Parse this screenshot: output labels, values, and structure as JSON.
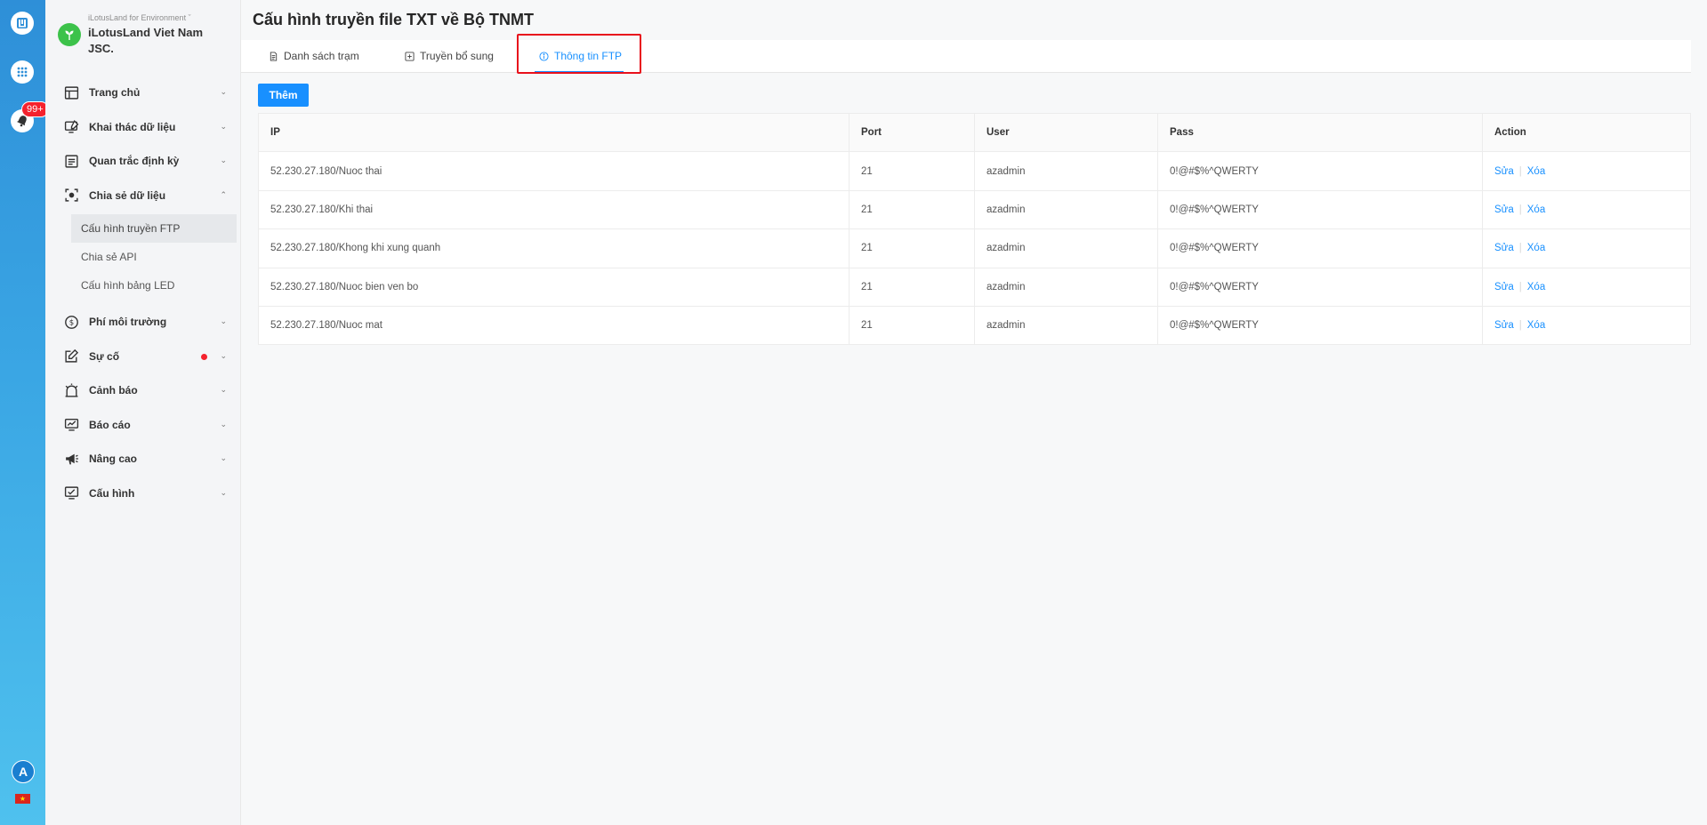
{
  "rail": {
    "badge_count": "99+",
    "avatar_letter": "A",
    "flag_star": "★"
  },
  "org": {
    "subtitle": "iLotusLand for Environment ˇ",
    "name": "iLotusLand Viet Nam JSC."
  },
  "menu": {
    "items": [
      {
        "label": "Trang chủ",
        "icon": "layout-icon"
      },
      {
        "label": "Khai thác dữ liệu",
        "icon": "monitor-edit-icon"
      },
      {
        "label": "Quan trắc định kỳ",
        "icon": "list-doc-icon"
      },
      {
        "label": "Chia sẻ dữ liệu",
        "icon": "share-scan-icon"
      },
      {
        "label": "Phí môi trường",
        "icon": "dollar-icon"
      },
      {
        "label": "Sự cố",
        "icon": "edit-icon"
      },
      {
        "label": "Cảnh báo",
        "icon": "alarm-icon"
      },
      {
        "label": "Báo cáo",
        "icon": "report-icon"
      },
      {
        "label": "Nâng cao",
        "icon": "megaphone-icon"
      },
      {
        "label": "Cấu hình",
        "icon": "config-icon"
      }
    ],
    "share_submenu": [
      "Cấu hình truyền FTP",
      "Chia sẻ API",
      "Cấu hình bảng LED"
    ]
  },
  "page": {
    "title": "Cấu hình truyền file TXT về Bộ TNMT",
    "tabs": [
      {
        "label": "Danh sách trạm"
      },
      {
        "label": "Truyền bổ sung"
      },
      {
        "label": "Thông tin FTP"
      }
    ],
    "add_button": "Thêm"
  },
  "table": {
    "columns": [
      "IP",
      "Port",
      "User",
      "Pass",
      "Action"
    ],
    "rows": [
      {
        "ip": "52.230.27.180/Nuoc thai",
        "port": "21",
        "user": "azadmin",
        "pass": "0!@#$%^QWERTY"
      },
      {
        "ip": "52.230.27.180/Khi thai",
        "port": "21",
        "user": "azadmin",
        "pass": "0!@#$%^QWERTY"
      },
      {
        "ip": "52.230.27.180/Khong khi xung quanh",
        "port": "21",
        "user": "azadmin",
        "pass": "0!@#$%^QWERTY"
      },
      {
        "ip": "52.230.27.180/Nuoc bien ven bo",
        "port": "21",
        "user": "azadmin",
        "pass": "0!@#$%^QWERTY"
      },
      {
        "ip": "52.230.27.180/Nuoc mat",
        "port": "21",
        "user": "azadmin",
        "pass": "0!@#$%^QWERTY"
      }
    ],
    "action_edit": "Sửa",
    "action_delete": "Xóa"
  },
  "colors": {
    "accent": "#1890ff",
    "highlight_box": "#e8111c",
    "rail_top": "#2e8fd8",
    "rail_bottom": "#4fc1ee",
    "logo_green": "#3cc24a"
  }
}
